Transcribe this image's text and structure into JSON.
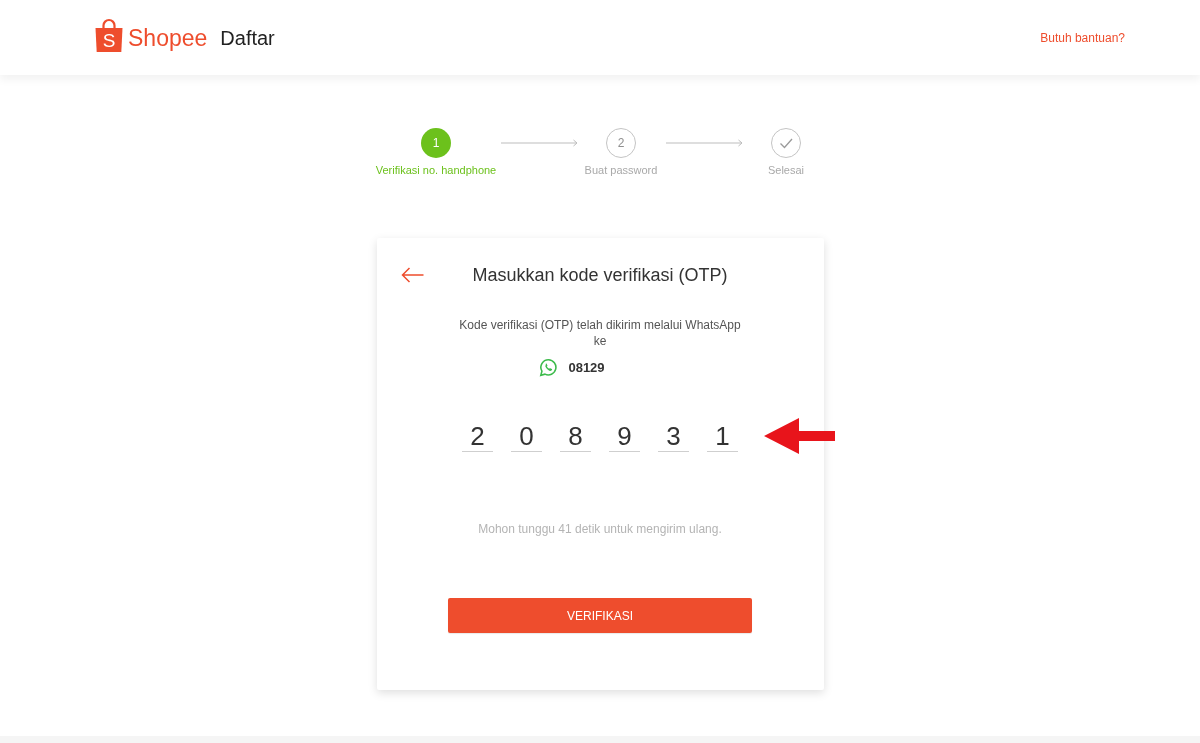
{
  "header": {
    "logo_letter": "S",
    "brand": "Shopee",
    "page_title": "Daftar",
    "help_link": "Butuh bantuan?"
  },
  "stepper": {
    "steps": [
      {
        "kind": "number",
        "number": "1",
        "label": "Verifikasi no. handphone",
        "active": true
      },
      {
        "kind": "number",
        "number": "2",
        "label": "Buat password",
        "active": false
      },
      {
        "kind": "check",
        "label": "Selesai",
        "active": false
      }
    ]
  },
  "otp_card": {
    "title": "Masukkan kode verifikasi (OTP)",
    "message": "Kode verifikasi (OTP) telah dikirim melalui WhatsApp ke",
    "whatsapp_number": "08129",
    "otp_digits": [
      "2",
      "0",
      "8",
      "9",
      "3",
      "1"
    ],
    "resend_note": "Mohon tunggu 41 detik untuk mengirim ulang.",
    "verify_button": "VERIFIKASI",
    "annotations": [
      {
        "kind": "arrow"
      }
    ]
  }
}
